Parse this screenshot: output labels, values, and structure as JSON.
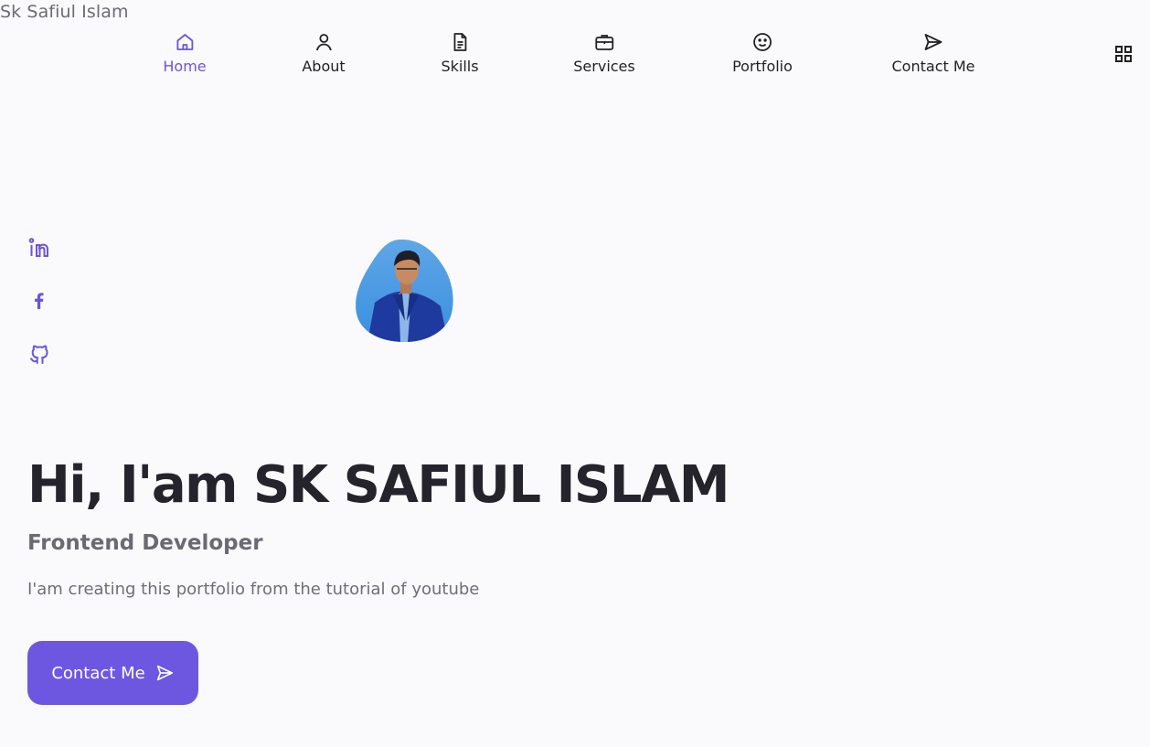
{
  "brand": {
    "name": "Sk Safiul Islam"
  },
  "nav": {
    "items": [
      {
        "label": "Home",
        "icon": "home-icon",
        "active": true
      },
      {
        "label": "About",
        "icon": "user-icon"
      },
      {
        "label": "Skills",
        "icon": "file-icon"
      },
      {
        "label": "Services",
        "icon": "briefcase-icon"
      },
      {
        "label": "Portfolio",
        "icon": "smile-icon"
      },
      {
        "label": "Contact Me",
        "icon": "send-icon"
      }
    ],
    "menu_icon": "grid-icon"
  },
  "social": [
    {
      "icon": "linkedin-icon"
    },
    {
      "icon": "facebook-icon"
    },
    {
      "icon": "github-icon"
    }
  ],
  "hero": {
    "title": "Hi, I'am SK SAFIUL ISLAM",
    "subtitle": "Frontend Developer",
    "description": "I'am creating this portfolio from the tutorial of youtube",
    "button_label": "Contact Me",
    "button_icon": "send-icon"
  },
  "colors": {
    "accent": "#6e57e0",
    "title": "#25232b",
    "text": "#6e6e78",
    "background": "#fafafc"
  }
}
